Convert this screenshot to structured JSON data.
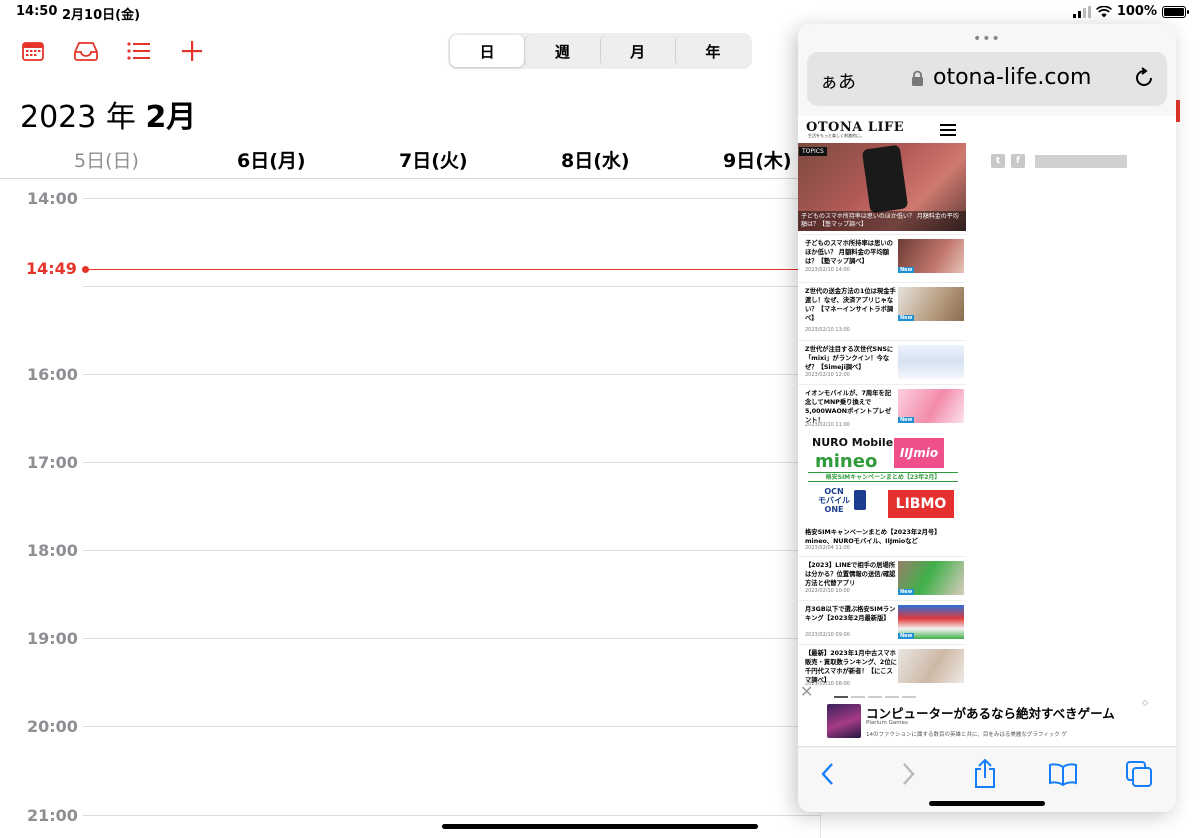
{
  "status_bar": {
    "time": "14:50",
    "date": "2月10日(金)",
    "battery": "100%",
    "battery_level": 1.0
  },
  "calendar": {
    "toolbar_icons": [
      "calendar-icon",
      "inbox-icon",
      "list-icon",
      "plus-icon"
    ],
    "view_tabs": [
      "日",
      "週",
      "月",
      "年"
    ],
    "active_view": "日",
    "month_title": {
      "year": "2023 年",
      "month": "2月"
    },
    "days": [
      "5日(日)",
      "6日(月)",
      "7日(火)",
      "8日(水)",
      "9日(木)"
    ],
    "hours": [
      "14:00",
      "16:00",
      "17:00",
      "18:00",
      "19:00",
      "20:00",
      "21:00"
    ],
    "now": "14:49",
    "accent_color": "#e5352b"
  },
  "safari": {
    "text_size_button": "ぁあ",
    "url": "otona-life.com",
    "site": {
      "logo": "OTONA LIFE",
      "tagline": "生活をもっと楽しく刺激的に。"
    },
    "hero": {
      "tag": "TOPICS",
      "caption": "子どものスマホ所持率は思いのほか低い？ 月額料金の平均額は？【塾マップ調べ】"
    },
    "articles": [
      {
        "title": "子どものスマホ所持率は思いのほか低い？ 月額料金の平均額は？【塾マップ調べ】",
        "date": "2023/02/10 14:00",
        "badge": "New"
      },
      {
        "title": "Z世代の送金方法の1位は現金手渡し！なぜ、決済アプリじゃない？【マネーインサイトラボ調べ】",
        "date": "2023/02/10 13:00",
        "badge": "New"
      },
      {
        "title": "Z世代が注目する次世代SNSに「mixi」がランクイン！今なぜ？【Simeji調べ】",
        "date": "2023/02/10 12:00",
        "badge": ""
      },
      {
        "title": "イオンモバイルが、7周年を記念してMNP乗り換えで5,000WAONポイントプレゼント！",
        "date": "2023/02/10 11:00",
        "badge": "New"
      }
    ],
    "sim_banner": {
      "nuro": "NURO Mobile",
      "mineo": "mineo",
      "iij": "IIJmio",
      "strip": "格安SIMキャンペーンまとめ【23年2月】",
      "ocn": "OCN\nモバイル\nONE",
      "libmo": "LIBMO"
    },
    "articles2": [
      {
        "title": "格安SIMキャンペーンまとめ【2023年2月号】mineo、NUROモバイル、IIJmioなど",
        "date": "2023/02/04 11:00",
        "badge": ""
      },
      {
        "title": "【2023】LINEで相手の居場所は分かる？位置情報の送信/確認方法と代替アプリ",
        "date": "2023/02/10 10:00",
        "badge": "New"
      },
      {
        "title": "月3GB以下で選ぶ格安SIMランキング【2023年2月最新版】",
        "date": "2023/02/10 09:00",
        "badge": "New"
      },
      {
        "title": "【最新】2023年1月中古スマホ販売・買取数ランキング、2位に千円代スマホが新者！【にこスマ調べ】",
        "date": "2023/02/10 08:00",
        "badge": ""
      }
    ],
    "ad": {
      "title": "コンピューターがあるなら絶対すべきゲーム",
      "sponsor": "Plarium Games",
      "desc": "14のファクションに属する数百の英雄と共に、目をみはる美麗なグラフィック ゲ"
    },
    "toolbar_icons": [
      "back-icon",
      "forward-icon",
      "share-icon",
      "bookmarks-icon",
      "tabs-icon"
    ]
  }
}
